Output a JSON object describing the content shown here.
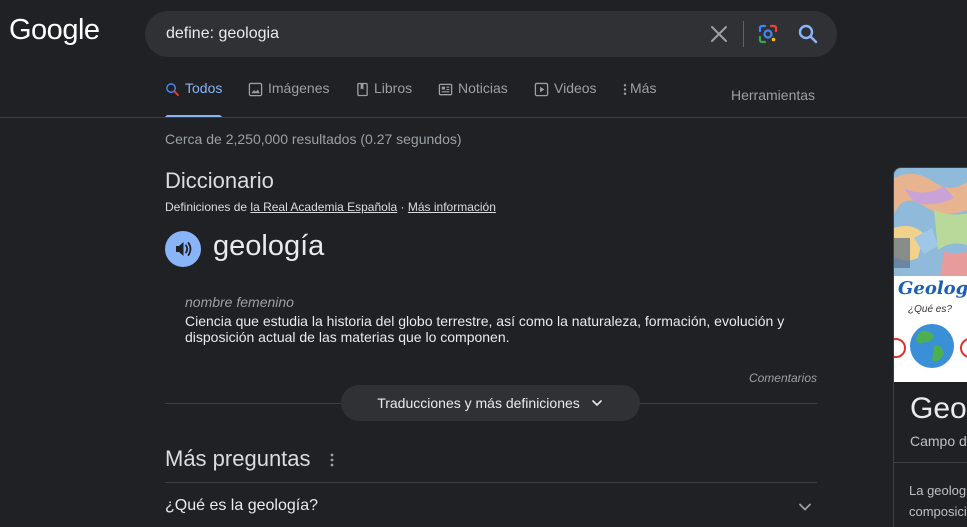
{
  "header": {
    "logo_text": "Google",
    "query": "define: geologia"
  },
  "tabs": [
    {
      "label": "Todos",
      "icon": "search-icon",
      "active": true
    },
    {
      "label": "Imágenes",
      "icon": "image-icon"
    },
    {
      "label": "Libros",
      "icon": "book-icon"
    },
    {
      "label": "Noticias",
      "icon": "news-icon"
    },
    {
      "label": "Videos",
      "icon": "play-icon"
    },
    {
      "label": "Más",
      "icon": "more-vert-icon"
    }
  ],
  "tools_label": "Herramientas",
  "stats": "Cerca de 2,250,000 resultados (0.27 segundos)",
  "dictionary": {
    "title": "Diccionario",
    "source_prefix": "Definiciones de",
    "source_link": "la Real Academia Española",
    "source_sep": "·",
    "more_info": "Más información",
    "word": "geología",
    "part_of_speech": "nombre femenino",
    "definition": "Ciencia que estudia la historia del globo terrestre, así como la naturaleza, formación, evolución y disposición actual de las materias que lo componen.",
    "feedback": "Comentarios",
    "more_definitions": "Traducciones y más definiciones"
  },
  "related_questions": {
    "title": "Más preguntas",
    "questions": [
      "¿Qué es la geología?"
    ]
  },
  "knowledge_panel": {
    "image_caption": "Geología",
    "image_subcaption": "¿Qué es?",
    "name": "Geología",
    "subtitle": "Campo de estudio",
    "description": "La geología estudia la composición"
  },
  "colors": {
    "background": "#202124",
    "accent": "#8ab4f8",
    "search_bg": "#303134"
  }
}
